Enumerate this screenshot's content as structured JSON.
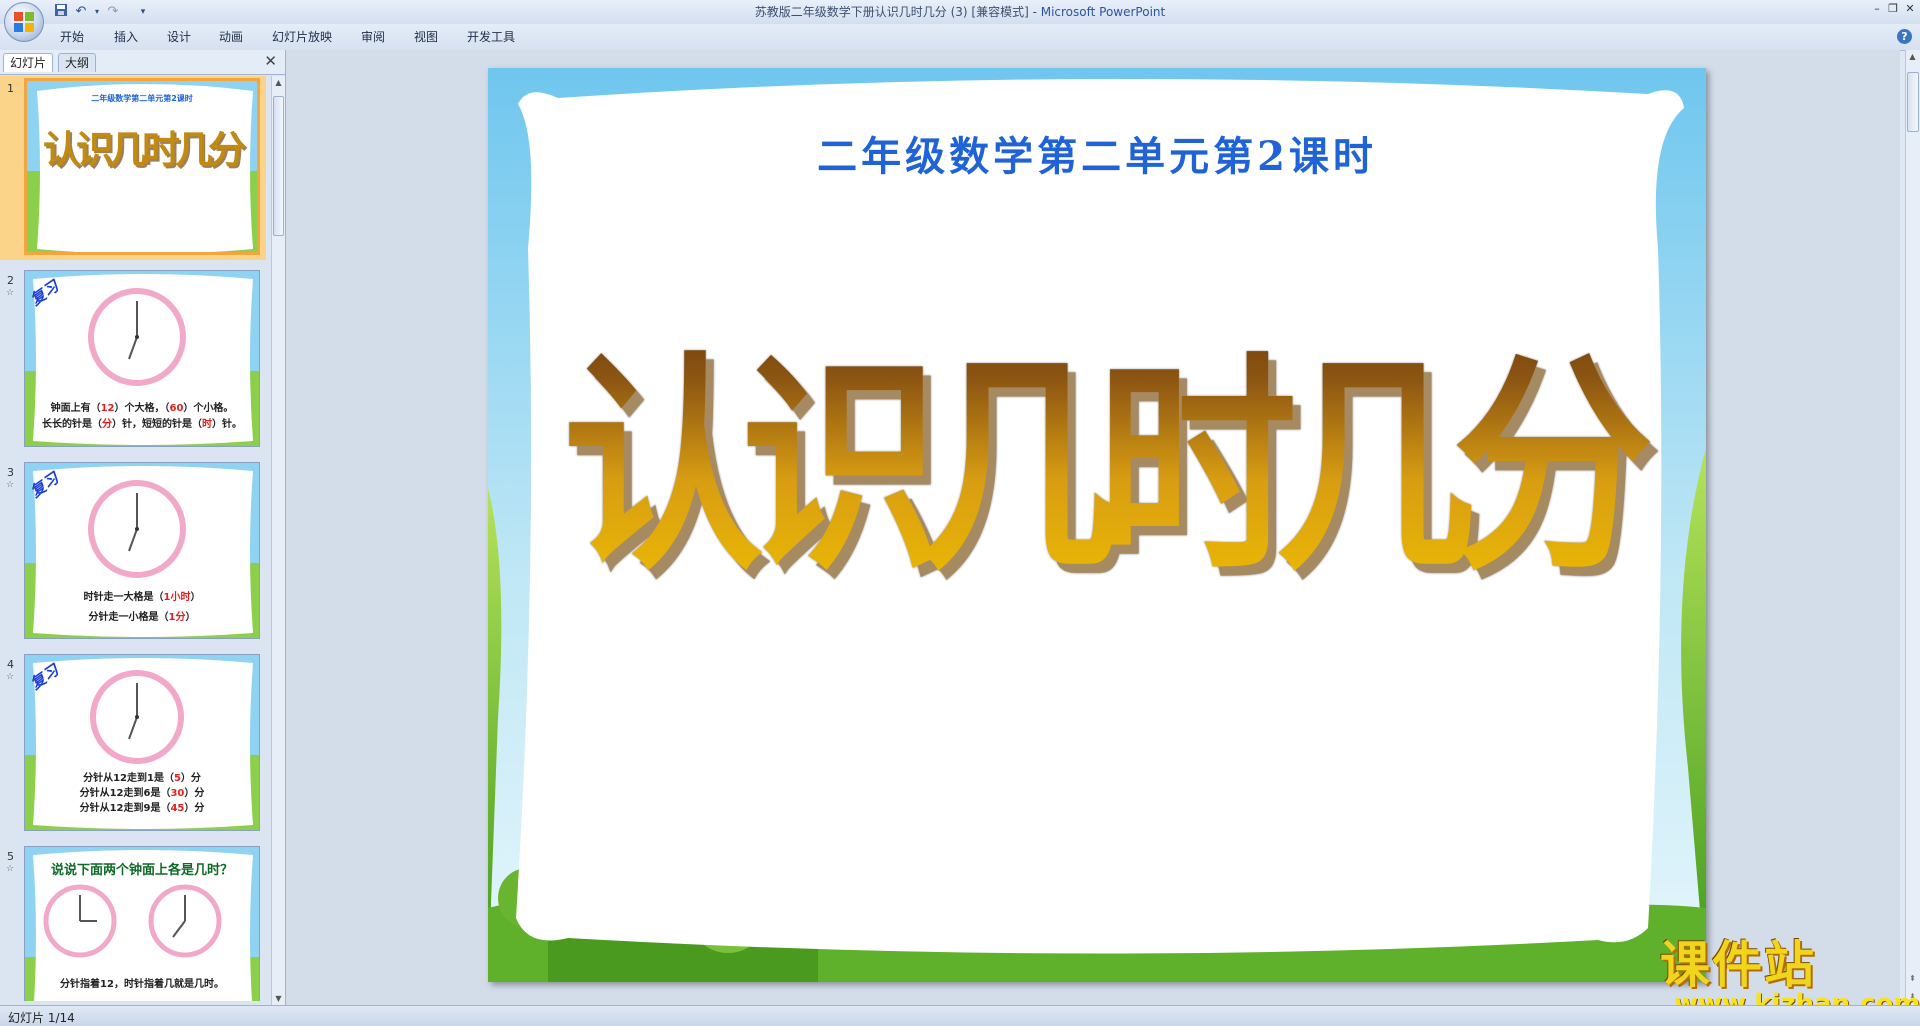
{
  "window": {
    "title_prefix": "苏教版二年级数学下册认识几时几分 (3) [兼容模式] - ",
    "app_name": "Microsoft PowerPoint"
  },
  "ribbon": {
    "tabs": [
      "开始",
      "插入",
      "设计",
      "动画",
      "幻灯片放映",
      "审阅",
      "视图",
      "开发工具"
    ]
  },
  "pane": {
    "tab_slides": "幻灯片",
    "tab_outline": "大纲",
    "close": "✕"
  },
  "thumbnails": [
    {
      "num": "1",
      "title": "二年级数学第二单元第2课时",
      "big": "认识几时几分"
    },
    {
      "num": "2",
      "badge": "复习",
      "line1_a": "钟面上有（",
      "line1_b": "12",
      "line1_c": "）个大格，（",
      "line1_d": "60",
      "line1_e": "）个小格。",
      "line2_a": "长长的针是（",
      "line2_b": "分",
      "line2_c": "）针，短短的针是（",
      "line2_d": "时",
      "line2_e": "）针。"
    },
    {
      "num": "3",
      "badge": "复习",
      "line1_a": "时针走一大格是（",
      "line1_b": "1小时",
      "line1_c": "）",
      "line2_a": "分针走一小格是（",
      "line2_b": "1分",
      "line2_c": "）"
    },
    {
      "num": "4",
      "badge": "复习",
      "l1a": "分针从12走到1是（",
      "l1b": "5",
      "l2a": "分针从12走到6是（",
      "l2b": "30",
      "l3a": "分针从12走到9是（",
      "l3b": "45",
      "suffix": "）分"
    },
    {
      "num": "5",
      "title": "说说下面两个钟面上各是几时？",
      "caption": "分针指着12，时针指着几就是几时。"
    }
  ],
  "slide": {
    "subtitle": "二年级数学第二单元第2课时",
    "title": "认识几时几分"
  },
  "watermark": {
    "big": "课件站",
    "small": "www.kjzhan.com"
  },
  "status": {
    "text": "幻灯片 1/14"
  },
  "colors": {
    "accent": "#1f63d6",
    "selection": "#f2a640"
  }
}
